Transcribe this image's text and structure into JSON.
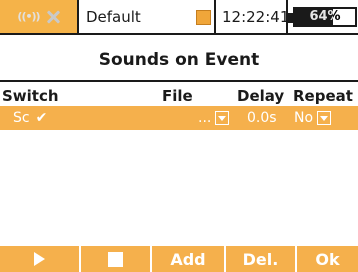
{
  "status": {
    "model_name": "Default",
    "time": "12:22:41",
    "battery_percent": 64,
    "battery_label": "64%",
    "signal_icon": "wifi-signal-icon",
    "signal_glyph": "((•))",
    "no_connection_icon": "x-icon"
  },
  "page": {
    "title": "Sounds on Event"
  },
  "table": {
    "columns": [
      "Switch",
      "File",
      "Delay",
      "Repeat"
    ],
    "rows": [
      {
        "switch": "Sc",
        "switch_state": "✔",
        "file": "...",
        "delay": "0.0s",
        "repeat": "No"
      }
    ]
  },
  "buttons": {
    "add": "Add",
    "delete": "Del.",
    "ok": "Ok"
  },
  "colors": {
    "accent": "#f5b04c",
    "text": "#1a1a1a"
  }
}
